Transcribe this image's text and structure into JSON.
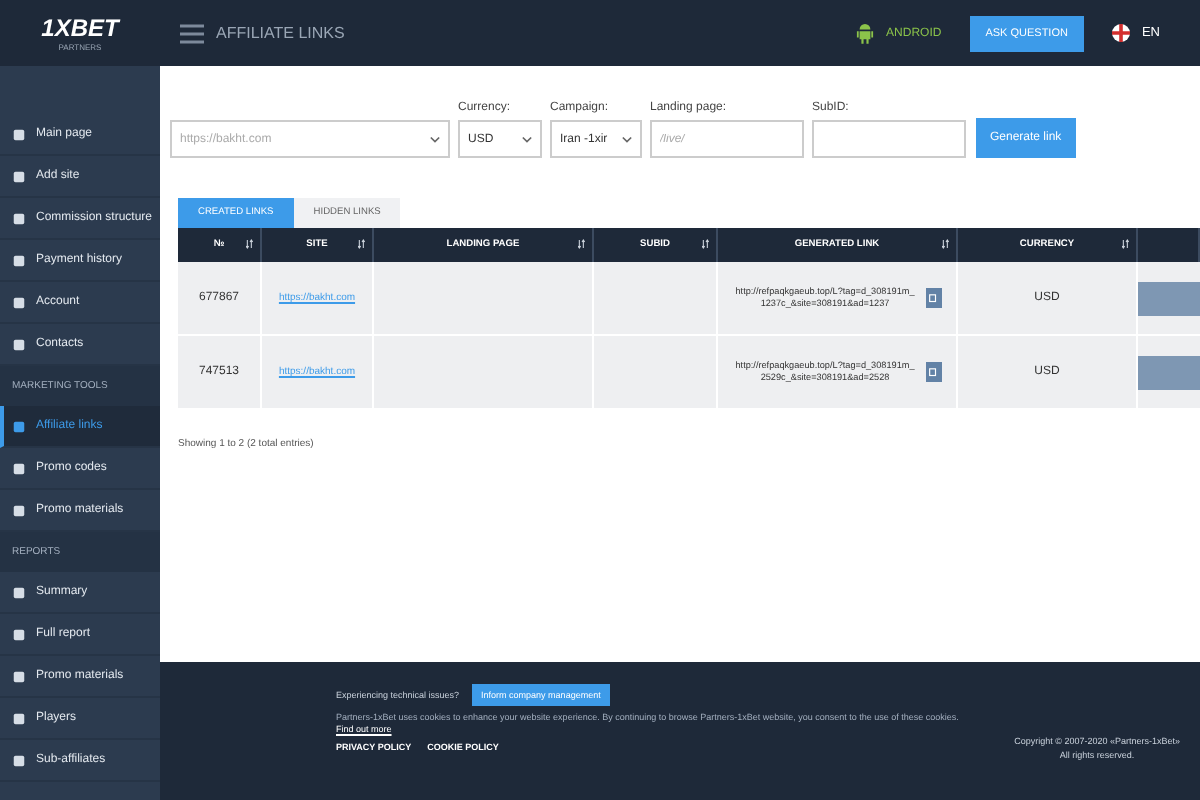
{
  "header": {
    "logo": "1XBET",
    "logo_sub": "PARTNERS",
    "title": "AFFILIATE LINKS",
    "android": "ANDROID",
    "ask_button": "ASK QUESTION",
    "language": "EN"
  },
  "sidebar": {
    "items": [
      {
        "kind": "item",
        "label": "Main page",
        "selected": false
      },
      {
        "kind": "item",
        "label": "Add site",
        "selected": false
      },
      {
        "kind": "item",
        "label": "Commission structure",
        "selected": false
      },
      {
        "kind": "item",
        "label": "Payment history",
        "selected": false
      },
      {
        "kind": "item",
        "label": "Account",
        "selected": false
      },
      {
        "kind": "item",
        "label": "Contacts",
        "selected": false
      },
      {
        "kind": "section",
        "label": "MARKETING TOOLS"
      },
      {
        "kind": "item",
        "label": "Affiliate links",
        "selected": true
      },
      {
        "kind": "item",
        "label": "Promo codes",
        "selected": false
      },
      {
        "kind": "item",
        "label": "Promo materials",
        "selected": false
      },
      {
        "kind": "section",
        "label": "REPORTS"
      },
      {
        "kind": "item",
        "label": "Summary",
        "selected": false
      },
      {
        "kind": "item",
        "label": "Full report",
        "selected": false
      },
      {
        "kind": "item",
        "label": "Promo materials",
        "selected": false
      },
      {
        "kind": "item",
        "label": "Players",
        "selected": false
      },
      {
        "kind": "item",
        "label": "Sub-affiliates",
        "selected": false
      }
    ]
  },
  "form": {
    "site": {
      "placeholder": "https://bakht.com"
    },
    "currency": {
      "label": "Currency:",
      "value": "USD"
    },
    "campaign": {
      "label": "Campaign:",
      "value": "Iran -1xir"
    },
    "landing": {
      "label": "Landing page:",
      "placeholder": "/live/"
    },
    "subid": {
      "label": "SubID:"
    },
    "button": "Generate link"
  },
  "tabs": [
    {
      "label": "CREATED LINKS",
      "selected": true
    },
    {
      "label": "HIDDEN LINKS",
      "selected": false
    }
  ],
  "table": {
    "columns": [
      "№",
      "SITE",
      "LANDING PAGE",
      "SUBID",
      "GENERATED LINK",
      "CURRENCY"
    ],
    "rows": [
      {
        "id": "677867",
        "site": "https://bakht.com",
        "link": "http://refpaqkgaeub.top/L?tag=d_308191m_1237c_&site=308191&ad=1237",
        "currency": "USD"
      },
      {
        "id": "747513",
        "site": "https://bakht.com",
        "link": "http://refpaqkgaeub.top/L?tag=d_308191m_2529c_&site=308191&ad=2528",
        "currency": "USD"
      }
    ]
  },
  "entries": "Showing 1 to 2 (2 total entries)",
  "footer": {
    "issues": "Experiencing technical issues?",
    "inform_button": "Inform company management",
    "cookies": "Partners-1xBet uses cookies to enhance your website experience. By continuing to browse Partners-1xBet website, you consent to the use of these cookies.",
    "find_out": "Find out more",
    "links": [
      "PRIVACY POLICY",
      "COOKIE POLICY"
    ],
    "copyright": "Copyright © 2007-2020 «Partners-1xBet»",
    "rights": "All rights reserved."
  }
}
